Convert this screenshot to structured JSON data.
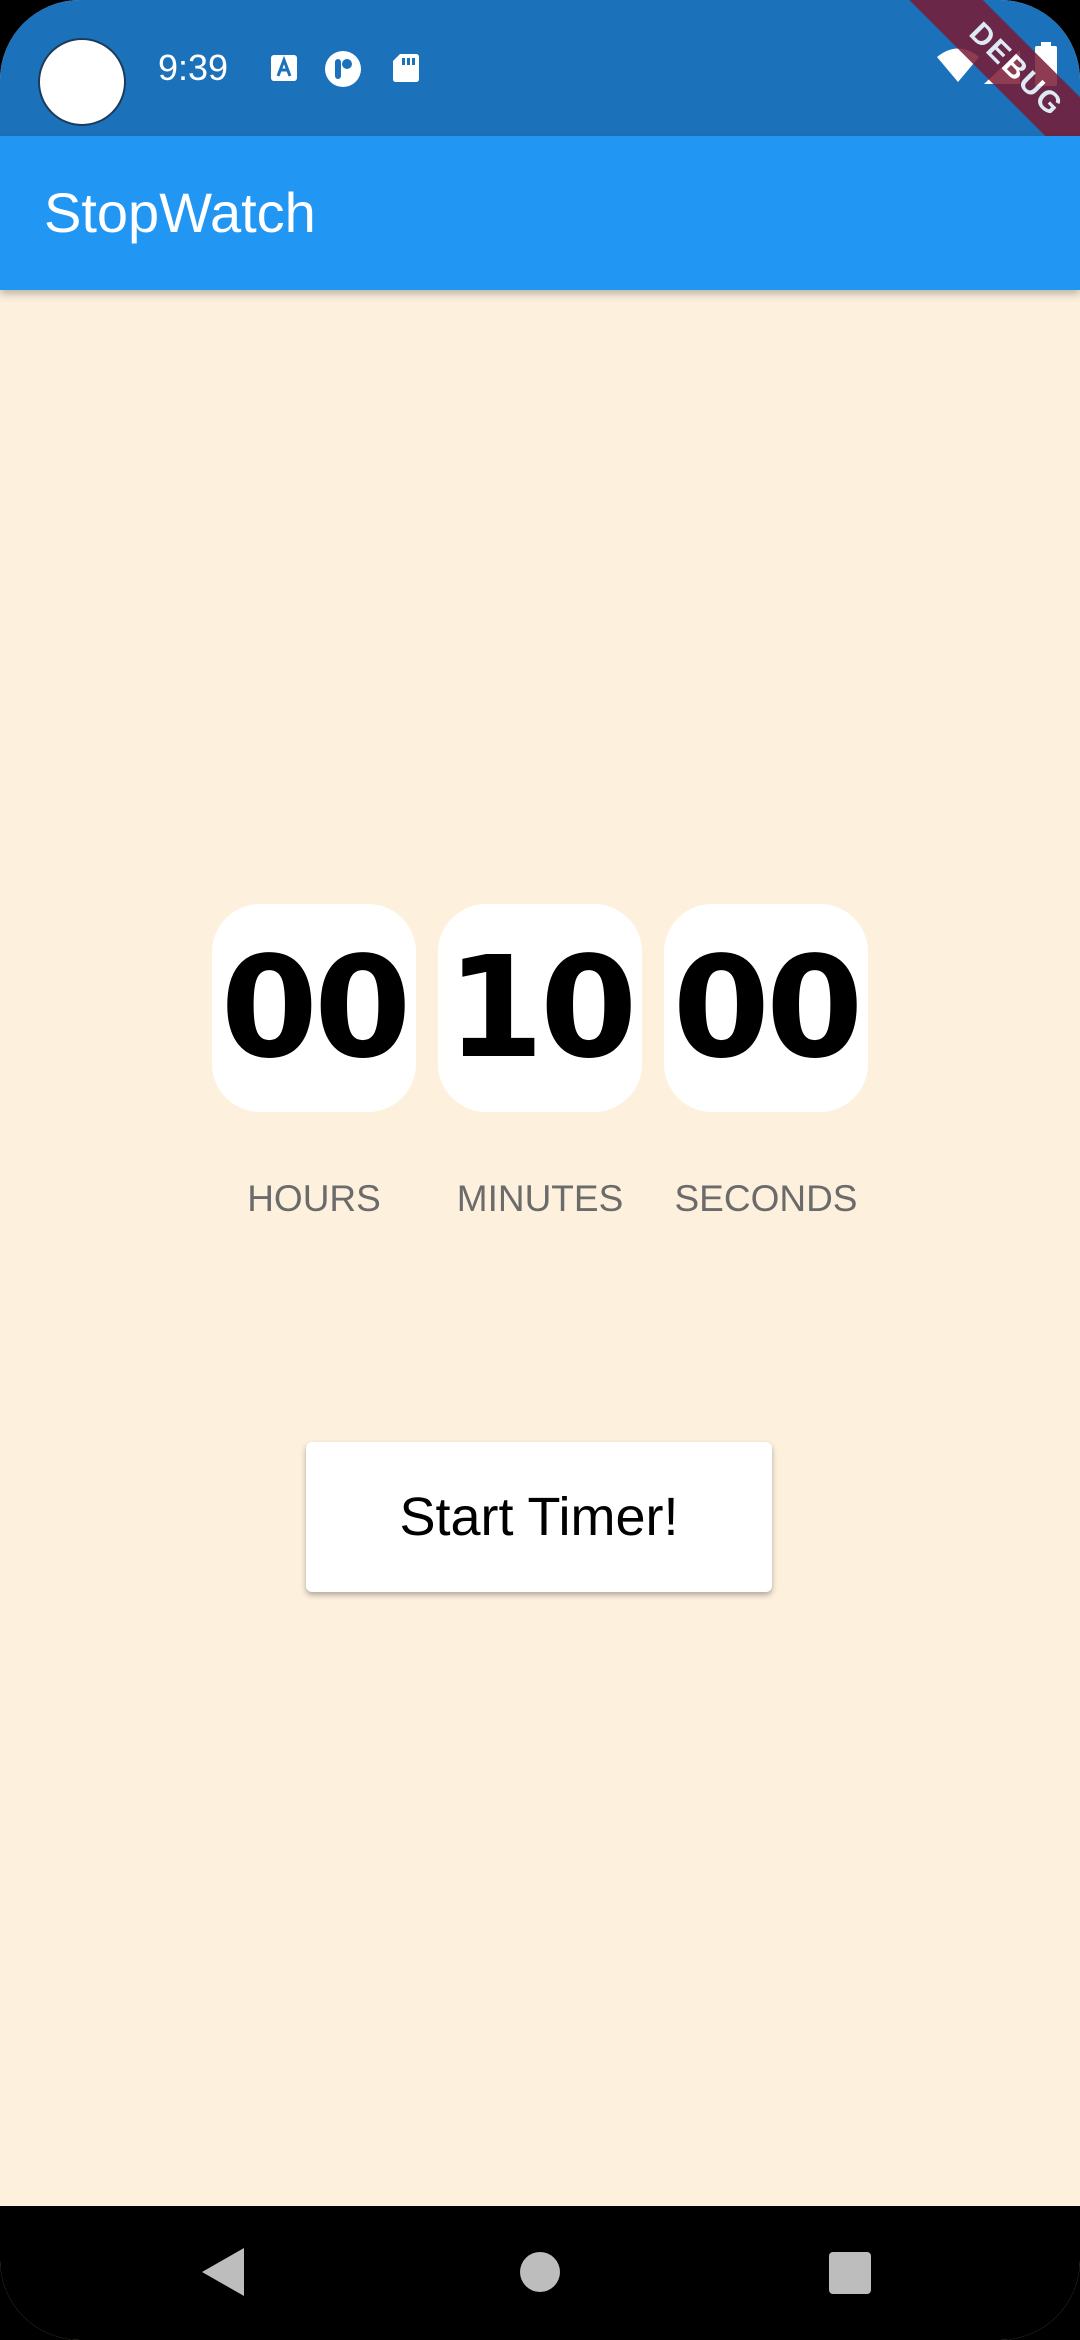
{
  "status_bar": {
    "time": "9:39",
    "debug_label": "DEBUG"
  },
  "app_bar": {
    "title": "StopWatch"
  },
  "timer": {
    "hours": "00",
    "minutes": "10",
    "seconds": "00",
    "hours_label": "HOURS",
    "minutes_label": "MINUTES",
    "seconds_label": "SECONDS"
  },
  "button": {
    "label": "Start Timer!"
  },
  "colors": {
    "status_bar": "#1C72BA",
    "app_bar": "#2196F3",
    "background": "#FDF0DD",
    "debug_banner": "#7A1A33"
  },
  "icons": {
    "status_left": [
      "a-icon",
      "p-icon",
      "sd-card-icon"
    ],
    "status_right": [
      "wifi-icon",
      "signal-icon",
      "battery-icon"
    ],
    "nav": [
      "back-icon",
      "home-icon",
      "recents-icon"
    ]
  }
}
